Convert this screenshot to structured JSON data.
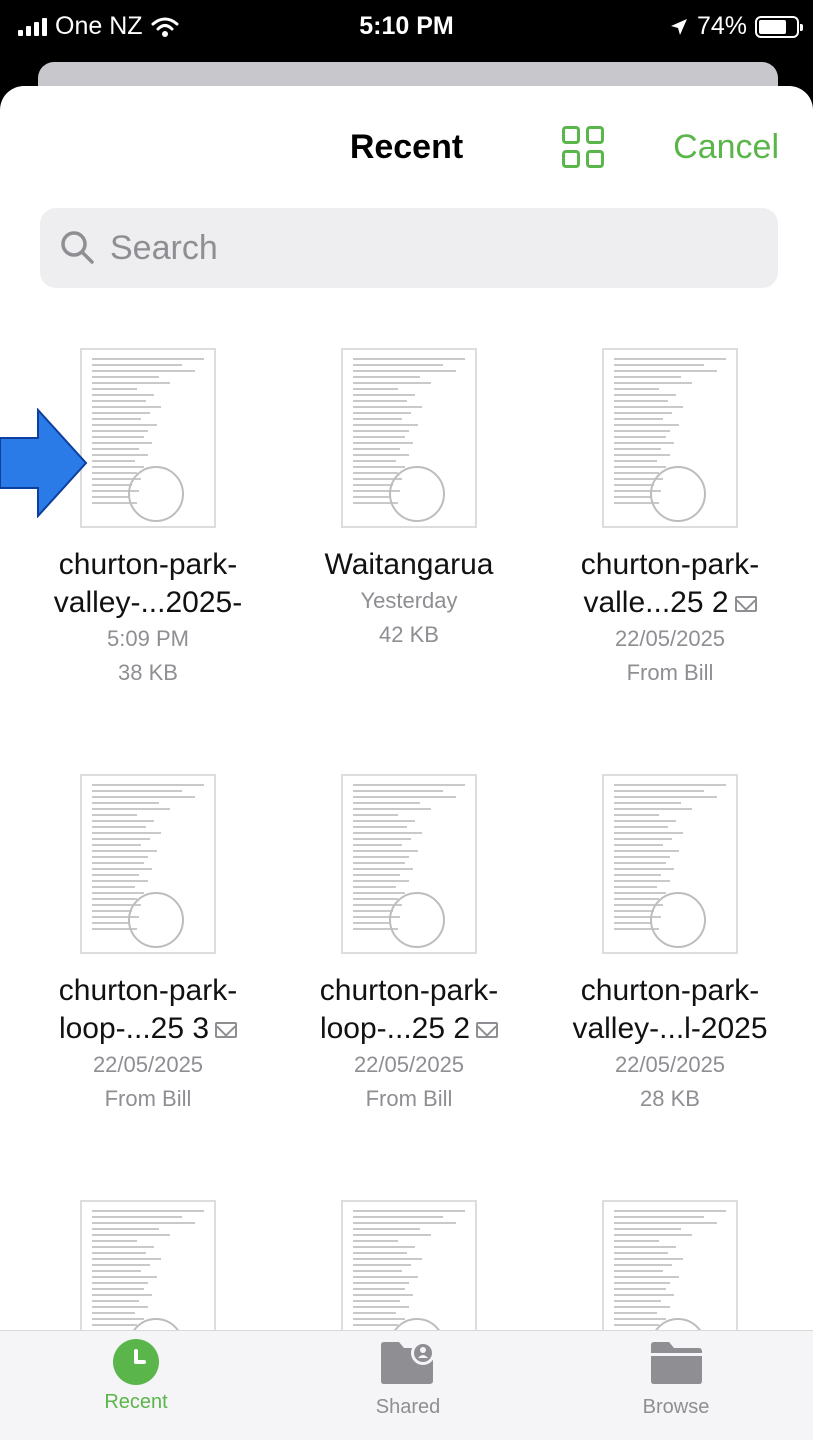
{
  "status_bar": {
    "carrier": "One NZ",
    "time": "5:10 PM",
    "battery": "74%",
    "battery_level": 0.74
  },
  "header": {
    "title": "Recent",
    "cancel_label": "Cancel",
    "view_toggle_icon": "grid-view-icon"
  },
  "search": {
    "placeholder": "Search"
  },
  "files": [
    {
      "name_line1": "churton-park-",
      "name_line2": "valley-...2025-",
      "date": "5:09 PM",
      "detail": "38 KB",
      "mail": false
    },
    {
      "name_line1": "Waitangarua",
      "name_line2": "",
      "date": "Yesterday",
      "detail": "42 KB",
      "mail": false
    },
    {
      "name_line1": "churton-park-",
      "name_line2": "valle...25 2",
      "date": "22/05/2025",
      "detail": "From Bill",
      "mail": true
    },
    {
      "name_line1": "churton-park-",
      "name_line2": "loop-...25 3",
      "date": "22/05/2025",
      "detail": "From Bill",
      "mail": true
    },
    {
      "name_line1": "churton-park-",
      "name_line2": "loop-...25 2",
      "date": "22/05/2025",
      "detail": "From Bill",
      "mail": true
    },
    {
      "name_line1": "churton-park-",
      "name_line2": "valley-...l-2025",
      "date": "22/05/2025",
      "detail": "28 KB",
      "mail": false
    },
    {
      "name_line1": "",
      "name_line2": "",
      "date": "",
      "detail": "",
      "mail": false
    },
    {
      "name_line1": "",
      "name_line2": "",
      "date": "",
      "detail": "",
      "mail": false
    },
    {
      "name_line1": "",
      "name_line2": "",
      "date": "",
      "detail": "",
      "mail": false
    }
  ],
  "tabs": [
    {
      "label": "Recent",
      "icon": "clock-icon",
      "active": true
    },
    {
      "label": "Shared",
      "icon": "shared-folder-icon",
      "active": false
    },
    {
      "label": "Browse",
      "icon": "folder-icon",
      "active": false
    }
  ],
  "colors": {
    "accent": "#5ab54a",
    "annotation": "#1f6fe6"
  }
}
